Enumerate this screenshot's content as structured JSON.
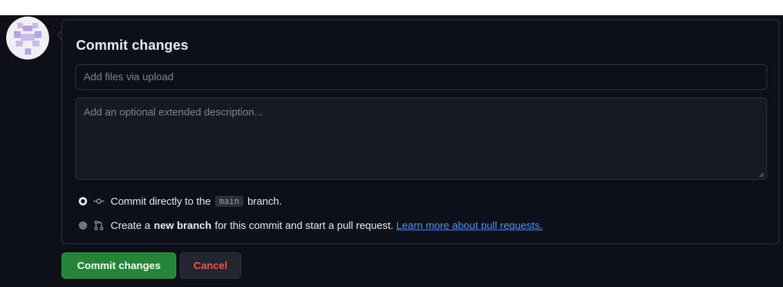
{
  "panel": {
    "title": "Commit changes"
  },
  "summary": {
    "placeholder": "Add files via upload"
  },
  "description": {
    "placeholder": "Add an optional extended description..."
  },
  "options": {
    "direct": {
      "before": "Commit directly to the",
      "branch": "main",
      "after": "branch.",
      "checked": true,
      "icon": "git-commit-icon"
    },
    "new_branch": {
      "before": "Create a",
      "bold": "new branch",
      "after": "for this commit and start a pull request.",
      "link": "Learn more about pull requests.",
      "checked": false,
      "icon": "git-pull-request-icon"
    }
  },
  "buttons": {
    "commit": "Commit changes",
    "cancel": "Cancel"
  },
  "colors": {
    "background": "#0d1117",
    "border": "#30363d",
    "primary_button": "#238636",
    "danger_text": "#f85149",
    "link": "#4493f8",
    "avatar_accent": "#b9a3e6"
  }
}
